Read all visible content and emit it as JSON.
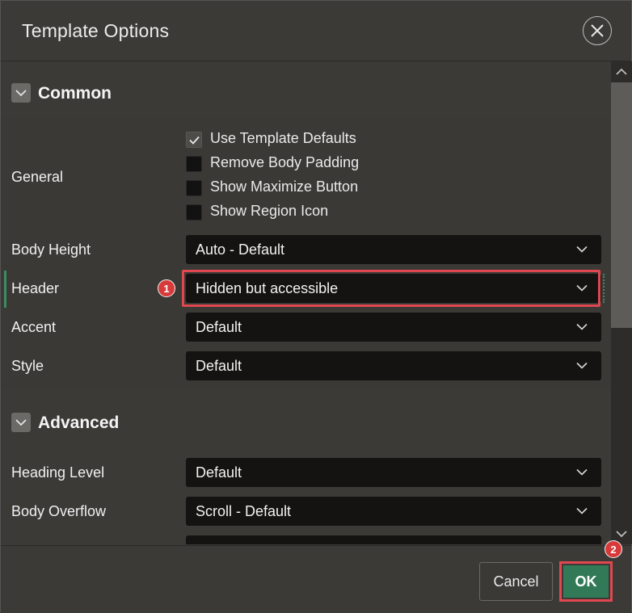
{
  "dialog": {
    "title": "Template Options",
    "close_icon": "close-icon"
  },
  "sections": {
    "common": {
      "title": "Common",
      "general": {
        "label": "General",
        "options": [
          {
            "label": "Use Template Defaults",
            "checked": true
          },
          {
            "label": "Remove Body Padding",
            "checked": false
          },
          {
            "label": "Show Maximize Button",
            "checked": false
          },
          {
            "label": "Show Region Icon",
            "checked": false
          }
        ]
      },
      "body_height": {
        "label": "Body Height",
        "value": "Auto - Default"
      },
      "header": {
        "label": "Header",
        "value": "Hidden but accessible",
        "callout": "1"
      },
      "accent": {
        "label": "Accent",
        "value": "Default"
      },
      "style": {
        "label": "Style",
        "value": "Default"
      }
    },
    "advanced": {
      "title": "Advanced",
      "heading_level": {
        "label": "Heading Level",
        "value": "Default"
      },
      "body_overflow": {
        "label": "Body Overflow",
        "value": "Scroll - Default"
      }
    }
  },
  "footer": {
    "cancel_label": "Cancel",
    "ok_label": "OK",
    "ok_callout": "2"
  },
  "colors": {
    "background": "#3b3a37",
    "select_bg": "#141312",
    "ok_green": "#327a57",
    "highlight_red": "#e0474f"
  }
}
